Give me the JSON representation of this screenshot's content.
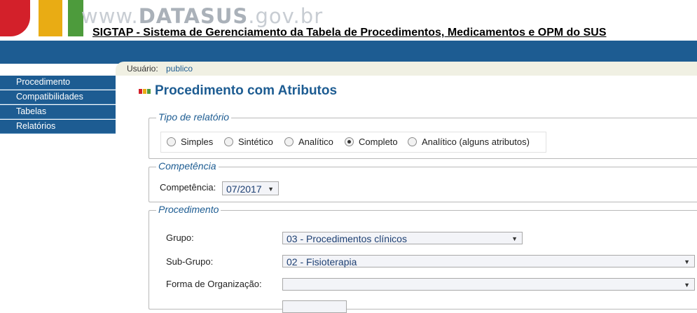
{
  "header": {
    "brand_prefix": "www.",
    "brand_strong": "DATASUS",
    "brand_suffix": ".gov.br",
    "system_title": "SIGTAP - Sistema de Gerenciamento da Tabela de Procedimentos, Medicamentos e OPM do SUS"
  },
  "userbar": {
    "label": "Usuário:",
    "value": "publico"
  },
  "sidebar": {
    "items": [
      {
        "label": "Procedimento"
      },
      {
        "label": "Compatibilidades"
      },
      {
        "label": "Tabelas"
      },
      {
        "label": "Relatórios"
      }
    ]
  },
  "page": {
    "title": "Procedimento com Atributos"
  },
  "tipo_relatorio": {
    "legend": "Tipo de relatório",
    "options": [
      {
        "label": "Simples",
        "selected": false
      },
      {
        "label": "Sintético",
        "selected": false
      },
      {
        "label": "Analítico",
        "selected": false
      },
      {
        "label": "Completo",
        "selected": true
      },
      {
        "label": "Analítico (alguns atributos)",
        "selected": false
      }
    ]
  },
  "competencia": {
    "legend": "Competência",
    "label": "Competência:",
    "value": "07/2017"
  },
  "procedimento": {
    "legend": "Procedimento",
    "grupo_label": "Grupo:",
    "grupo_value": "03 - Procedimentos clínicos",
    "subgrupo_label": "Sub-Grupo:",
    "subgrupo_value": "02 - Fisioterapia",
    "forma_label": "Forma de Organização:",
    "forma_value": ""
  },
  "colors": {
    "primary_blue": "#1d5c92",
    "logo_red": "#d3202a",
    "logo_yellow": "#e9ac14",
    "logo_green": "#4d9b3c"
  },
  "icons": {
    "dropdown": "chevron-down-icon",
    "logo": "datasus-logo"
  }
}
